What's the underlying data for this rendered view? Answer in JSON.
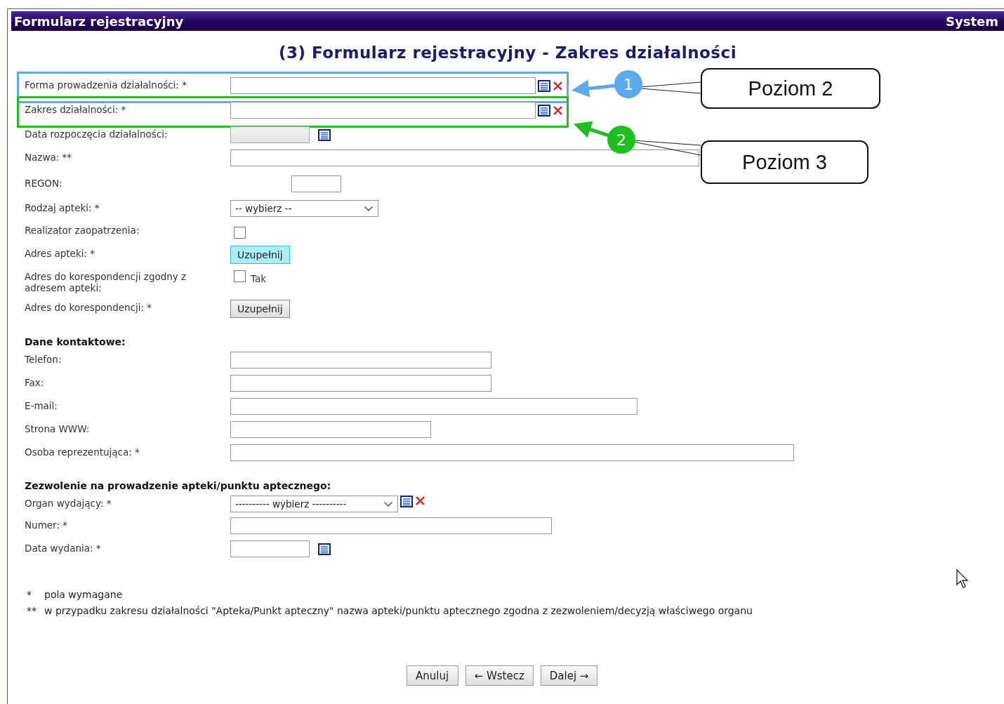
{
  "window": {
    "title": "Formularz rejestracyjny",
    "system_label": "System"
  },
  "heading": "(3) Formularz rejestracyjny - Zakres działalności",
  "sections": [
    {
      "rows": [
        {
          "kind": "lookup",
          "label": "Forma prowadzenia działalności: *",
          "highlighted": true
        },
        {
          "kind": "lookup",
          "label": "Zakres działalności: *",
          "highlighted": true
        },
        {
          "kind": "date",
          "label": "Data rozpoczęcia działalności:",
          "disabled": true
        },
        {
          "kind": "text",
          "label": "Nazwa: **"
        },
        {
          "kind": "text",
          "label": "REGON:"
        },
        {
          "kind": "select",
          "label": "Rodzaj apteki: *",
          "value": "-- wybierz --"
        },
        {
          "kind": "checkbox",
          "label": "Realizator zaopatrzenia:",
          "checked": false
        },
        {
          "kind": "action",
          "label": "Adres apteki: *",
          "button": "Uzupełnij",
          "focused": true
        },
        {
          "kind": "checkbox",
          "label": "Adres do korespondencji zgodny z adresem apteki:",
          "checked": false,
          "option": "Tak"
        },
        {
          "kind": "action",
          "label": "Adres do korespondencji: *",
          "button": "Uzupełnij",
          "focused": false
        }
      ]
    },
    {
      "title": "Dane kontaktowe:",
      "rows": [
        {
          "kind": "text",
          "label": "Telefon:"
        },
        {
          "kind": "text",
          "label": "Fax:"
        },
        {
          "kind": "text",
          "label": "E-mail:"
        },
        {
          "kind": "text",
          "label": "Strona WWW:"
        },
        {
          "kind": "text",
          "label": "Osoba reprezentująca: *"
        }
      ]
    },
    {
      "title": "Zezwolenie na prowadzenie apteki/punktu aptecznego:",
      "rows": [
        {
          "kind": "lookup-select",
          "label": "Organ wydający: *",
          "value": "---------- wybierz ----------"
        },
        {
          "kind": "text",
          "label": "Numer: *"
        },
        {
          "kind": "date",
          "label": "Data wydania: *",
          "disabled": false
        }
      ]
    }
  ],
  "footnotes": [
    {
      "mark": "*",
      "text": "pola wymagane"
    },
    {
      "mark": "**",
      "text": "w przypadku zakresu działalności \"Apteka/Punkt apteczny\" nazwa apteki/punktu aptecznego zgodna z zezwoleniem/decyzją właściwego organu"
    }
  ],
  "buttons": [
    {
      "label": "Anuluj"
    },
    {
      "label": "← Wstecz"
    },
    {
      "label": "Dalej →"
    }
  ],
  "annotations": [
    {
      "number": "1",
      "label": "Poziom 2",
      "color": "#5aaaf0"
    },
    {
      "number": "2",
      "label": "Poziom 3",
      "color": "#1fbf1f"
    }
  ]
}
